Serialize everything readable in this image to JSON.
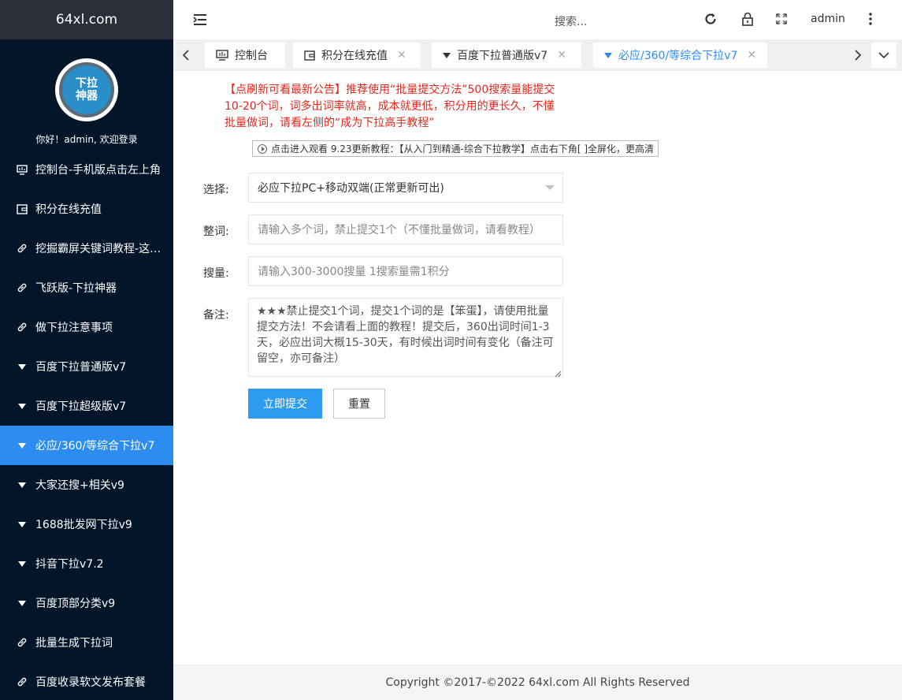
{
  "sidebar": {
    "brand": "64xl.com",
    "avatar_text_line1": "下拉",
    "avatar_text_line2": "神器",
    "welcome": "你好！admin, 欢迎登录",
    "items": [
      {
        "label": "控制台-手机版点击左上角",
        "icon": "monitor-icon"
      },
      {
        "label": "积分在线充值",
        "icon": "wallet-icon"
      },
      {
        "label": "挖掘霸屏关键词教程-这个一定要学",
        "icon": "link-icon"
      },
      {
        "label": "飞跃版-下拉神器",
        "icon": "link-icon"
      },
      {
        "label": "做下拉注意事项",
        "icon": "link-icon"
      },
      {
        "label": "百度下拉普通版v7",
        "icon": "triangle-down-icon"
      },
      {
        "label": "百度下拉超级版v7",
        "icon": "triangle-down-icon"
      },
      {
        "label": "必应/360/等综合下拉v7",
        "icon": "triangle-down-icon",
        "active": true
      },
      {
        "label": "大家还搜+相关v9",
        "icon": "triangle-down-icon"
      },
      {
        "label": "1688批发网下拉v9",
        "icon": "triangle-down-icon"
      },
      {
        "label": "抖音下拉v7.2",
        "icon": "triangle-down-icon"
      },
      {
        "label": "百度顶部分类v9",
        "icon": "triangle-down-icon"
      },
      {
        "label": "批量生成下拉词",
        "icon": "link-icon"
      },
      {
        "label": "百度收录软文发布套餐",
        "icon": "link-icon"
      }
    ]
  },
  "header": {
    "search_label": "搜索...",
    "user": "admin"
  },
  "tabs": [
    {
      "label": "控制台",
      "icon": "monitor-icon",
      "closable": false
    },
    {
      "label": "积分在线充值",
      "icon": "wallet-icon",
      "closable": true
    },
    {
      "label": "百度下拉普通版v7",
      "icon": "triangle-down-icon",
      "closable": true
    },
    {
      "label": "必应/360/等综合下拉v7",
      "icon": "triangle-down-icon",
      "closable": true,
      "active": true
    }
  ],
  "main": {
    "notice": "【点刷新可看最新公告】推荐使用“批量提交方法”500搜索量能提交10-20个词，词多出词率就高，成本就更低，积分用的更长久，不懂批量做词，请看左侧的“成为下拉高手教程”",
    "tutorial": "点击进入观看 9.23更新教程：【从入门到精通-综合下拉教学】点击右下角[ ]全屏化，更高清",
    "form": {
      "select_label": "选择:",
      "select_value": "必应下拉PC+移动双端(正常更新可出)",
      "words_label": "整词:",
      "words_placeholder": "请输入多个词，禁止提交1个（不懂批量做词，请看教程）",
      "volume_label": "搜量:",
      "volume_placeholder": "请输入300-3000搜量 1搜索量需1积分",
      "remark_label": "备注:",
      "remark_placeholder": "★★★禁止提交1个词，提交1个词的是【笨蛋】，请使用批量提交方法！不会请看上面的教程！提交后，360出词时间1-3天，必应出词大概15-30天，有时候出词时间有变化（备注可留空，亦可备注）",
      "submit_label": "立即提交",
      "reset_label": "重置"
    }
  },
  "footer": {
    "copyright": "Copyright ©2017-©2022 64xl.com All Rights Reserved"
  },
  "colors": {
    "sidebar_bg": "#021529",
    "brand_bar_bg": "#2b2f3a",
    "accent": "#2d8cf0",
    "notice_red": "#e4271c"
  }
}
